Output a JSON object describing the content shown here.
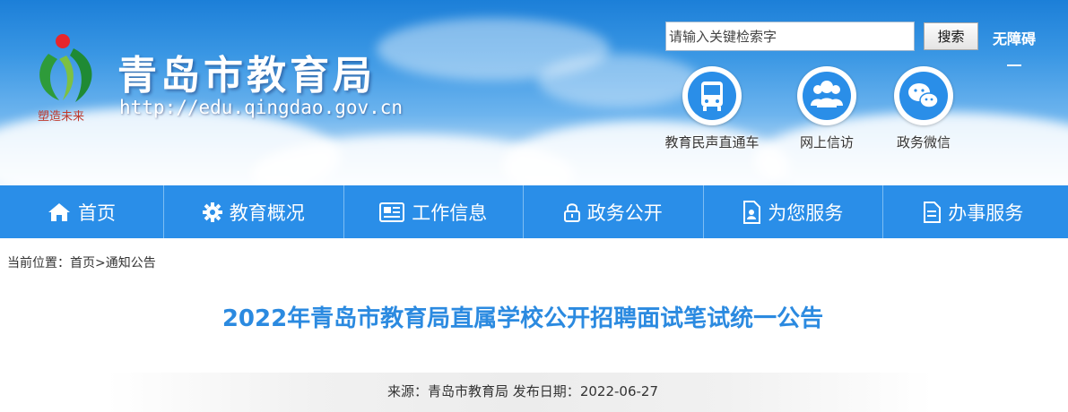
{
  "site": {
    "name": "青岛市教育局",
    "url": "http://edu.qingdao.gov.cn",
    "emblem_motto": "塑造未来"
  },
  "search": {
    "placeholder": "请输入关键检索字",
    "button_label": "搜索"
  },
  "accessibility_label": "无障碍",
  "quick_links": [
    {
      "label": "教育民声直通车",
      "icon": "bus-icon"
    },
    {
      "label": "网上信访",
      "icon": "users-icon"
    },
    {
      "label": "政务微信",
      "icon": "wechat-icon"
    }
  ],
  "nav": [
    {
      "label": "首页",
      "icon": "home-icon"
    },
    {
      "label": "教育概况",
      "icon": "gear-icon"
    },
    {
      "label": "工作信息",
      "icon": "newspaper-icon"
    },
    {
      "label": "政务公开",
      "icon": "lock-icon"
    },
    {
      "label": "为您服务",
      "icon": "document-user-icon"
    },
    {
      "label": "办事服务",
      "icon": "document-icon"
    }
  ],
  "breadcrumb": {
    "prefix": "当前位置：",
    "items": [
      "首页",
      "通知公告"
    ],
    "separator": ">"
  },
  "article": {
    "title": "2022年青岛市教育局直属学校公开招聘面试笔试统一公告",
    "source_label": "来源：",
    "source": "青岛市教育局",
    "date_label": "发布日期：",
    "date": "2022-06-27"
  },
  "colors": {
    "nav_bg": "#2a8ee8",
    "title": "#2b8ae0",
    "header_sky": "#3a97e4"
  }
}
